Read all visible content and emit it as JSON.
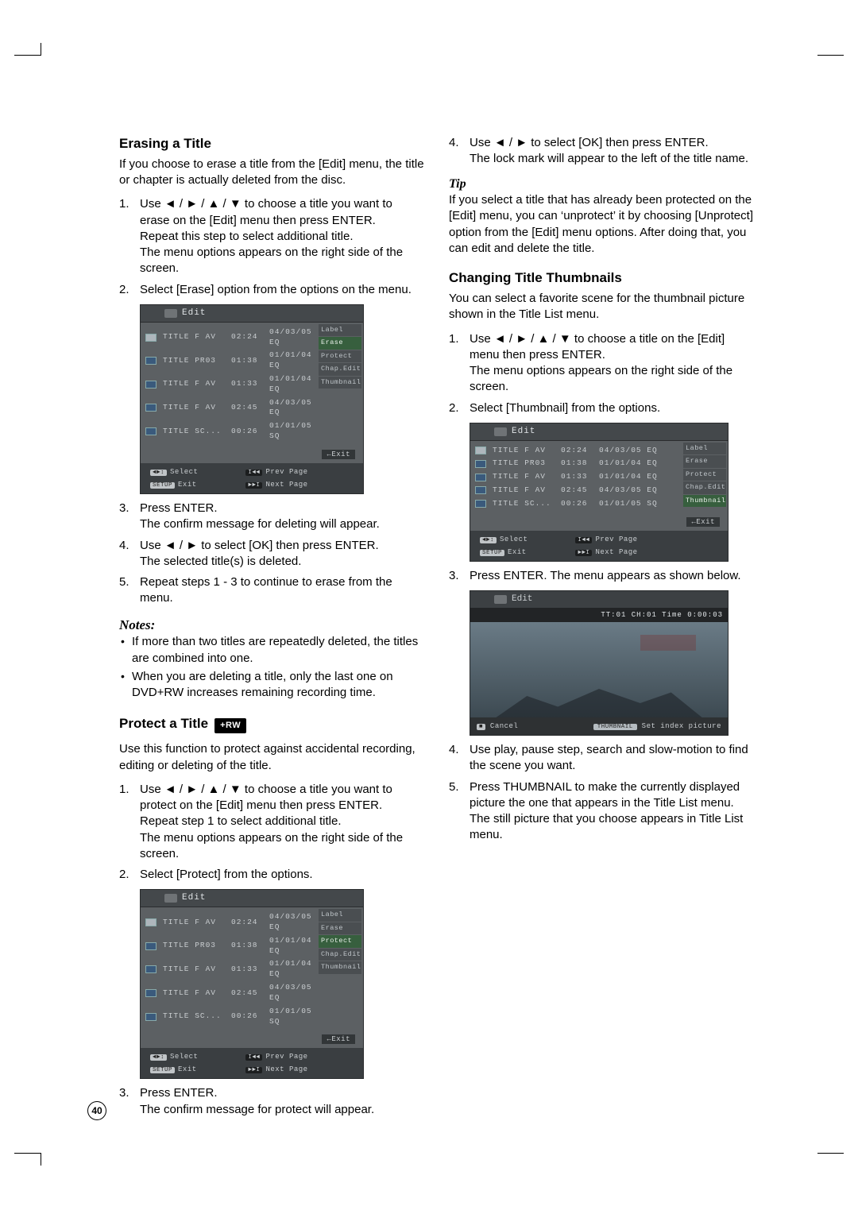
{
  "page_number": "40",
  "arrows": {
    "left": "◄",
    "right": "►",
    "up": "▲",
    "down": "▼"
  },
  "erase": {
    "heading": "Erasing a Title",
    "intro": "If you choose to erase a title from the [Edit] menu, the title or chapter is actually deleted from the disc.",
    "steps": [
      [
        "Use ◄ / ► / ▲ / ▼ to choose a title you want to erase on the [Edit] menu then press ENTER.",
        "Repeat this step to select additional title.",
        "The menu options appears on the right side of the screen."
      ],
      [
        "Select [Erase] option from the options on the menu."
      ]
    ],
    "steps2": [
      [
        "Press ENTER.",
        "The confirm message for deleting will appear."
      ],
      [
        "Use ◄ / ► to select [OK] then press ENTER.",
        "The selected title(s) is deleted."
      ],
      [
        "Repeat steps 1 - 3 to continue to erase from the menu."
      ]
    ]
  },
  "notes": {
    "heading": "Notes:",
    "items": [
      "If more than two titles are repeatedly deleted, the titles are combined into one.",
      "When you are deleting a title, only the last one on DVD+RW increases remaining recording time."
    ]
  },
  "protect": {
    "heading": "Protect a Title",
    "badge": "+RW",
    "intro": "Use this function to protect against accidental recording, editing or deleting of the title.",
    "steps": [
      [
        "Use ◄ / ► / ▲ / ▼ to choose a title you want to protect on the [Edit] menu then press ENTER.",
        "Repeat step 1 to select additional title.",
        "The menu options appears on the right side of the screen."
      ],
      [
        "Select [Protect] from the options."
      ]
    ],
    "steps2": [
      [
        "Press ENTER.",
        "The confirm message for protect will appear."
      ]
    ],
    "right_cont": [
      [
        "Use ◄ / ► to select [OK] then press ENTER.",
        "The lock mark will appear to the left of the title name."
      ]
    ]
  },
  "tip": {
    "heading": "Tip",
    "text": "If you select a title that has already been protected on the [Edit] menu, you can ‘unprotect’ it by choosing [Unprotect] option from the [Edit] menu options. After doing that, you can edit and delete the title."
  },
  "thumb": {
    "heading": "Changing Title Thumbnails",
    "intro": "You can select a favorite scene for the thumbnail picture shown in the Title List menu.",
    "steps": [
      [
        "Use ◄ / ► / ▲ / ▼ to choose a title on the [Edit] menu then press ENTER.",
        "The menu options appears on the right side of the screen."
      ],
      [
        "Select [Thumbnail] from the options."
      ]
    ],
    "steps2": [
      [
        "Press ENTER. The menu appears as shown below."
      ]
    ],
    "steps3": [
      [
        "Use play, pause step, search and slow-motion to find the scene you want."
      ],
      [
        "Press THUMBNAIL to make the currently displayed picture the one that appears in the Title List menu.",
        "The still picture that you choose appears in Title List menu."
      ]
    ]
  },
  "edit_menu": {
    "title": "Edit",
    "rows": [
      {
        "name": "TITLE F AV",
        "dur": "02:24",
        "date": "04/03/05 EQ"
      },
      {
        "name": "TITLE PR03",
        "dur": "01:38",
        "date": "01/01/04 EQ"
      },
      {
        "name": "TITLE F AV",
        "dur": "01:33",
        "date": "01/01/04 EQ"
      },
      {
        "name": "TITLE F AV",
        "dur": "02:45",
        "date": "04/03/05 EQ"
      },
      {
        "name": "TITLE SC...",
        "dur": "00:26",
        "date": "01/01/05 SQ"
      }
    ],
    "options": [
      "Label",
      "Erase",
      "Protect",
      "Chap.Edit",
      "Thumbnail"
    ],
    "exit": "←Exit",
    "select": "Select",
    "f_exit": "Exit",
    "prev": "Prev Page",
    "next": "Next Page",
    "select_badge": "◄►↕",
    "setup_badge": "SETUP",
    "skip_badge": "I◄◄",
    "fwd_badge": "►►I"
  },
  "preview": {
    "title": "Edit",
    "info": "TT:01 CH:01 Time 0:00:03",
    "cancel": "Cancel",
    "cancel_badge": "■",
    "set": "Set index picture",
    "set_badge": "THUMBNAIL"
  }
}
